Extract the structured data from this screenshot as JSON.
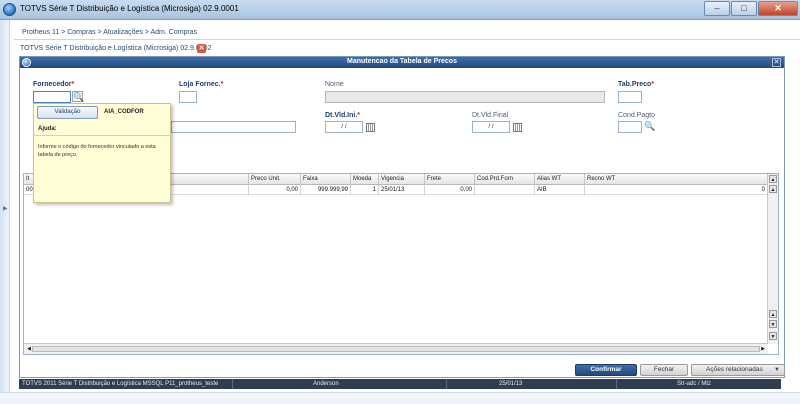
{
  "window": {
    "title": "TOTVS Série T Distribuição e Logística (Microsiga) 02.9.0001",
    "controls": {
      "minimize": "–",
      "maximize": "□",
      "close": "✕"
    }
  },
  "breadcrumb": "Protheus 11 > Compras > Atualizações > Adm. Compras",
  "subheader": {
    "title": "TOTVS Série T Distribuição e Logística (Microsiga) 02.9.0002",
    "close_glyph": "✕"
  },
  "dialog": {
    "title": "Manutencao da Tabela de Precos",
    "close_glyph": "✕",
    "fields": {
      "fornecedor": {
        "label": "Fornecedor",
        "value": ""
      },
      "loja": {
        "label": "Loja Fornec.",
        "value": ""
      },
      "nome": {
        "label": "Nome",
        "value": ""
      },
      "tab_preco": {
        "label": "Tab.Preco",
        "value": ""
      },
      "dt_vld_ini": {
        "label": "Dt.Vld.Ini.",
        "value": " /  /"
      },
      "dt_vld_final": {
        "label": "Dt.Vld.Final",
        "value": " /  /"
      },
      "cond_pagto": {
        "label": "Cond.Pagto",
        "value": ""
      },
      "descricao": {
        "value": ""
      }
    },
    "required_mark": "*"
  },
  "tooltip": {
    "button_label": "Validação",
    "field_name": "AIA_CODFOR",
    "heading": "Ajuda:",
    "message": "Informe o código do fornecedor vinculado a esta tabela de preço."
  },
  "grid": {
    "columns": {
      "c0": "It",
      "c1": "",
      "preco_unit": "Preco Unit.",
      "faixa": "Faixa",
      "moeda": "Moeda",
      "vigencia": "Vigencia",
      "frete": "Frete",
      "cod_prd_forn": "Cod.Prd.Forn",
      "alias_wt": "Alias WT",
      "recno_wt": "Recno WT"
    },
    "row": {
      "c0": "00",
      "c1": "",
      "preco_unit": "0,00",
      "faixa": "999.999,99",
      "moeda": "1",
      "vigencia": "25/01/13",
      "frete": "0,00",
      "cod_prd_forn": "",
      "alias_wt": "AIB",
      "recno_wt": "0"
    }
  },
  "buttons": {
    "confirmar": "Confirmar",
    "fechar": "Fechar",
    "acoes": "Ações relacionadas"
  },
  "statusbar": {
    "environment": "TOTVS 2011 Série T Distribuição e Logística MSSQL P11_protheus_teste",
    "user": "Anderson",
    "date": "25/01/13",
    "company": "Str-adc / Mtz"
  },
  "icons": {
    "lookup": "magnifier-icon",
    "calendar": "calendar-icon"
  },
  "colors": {
    "accent": "#22497d",
    "required_star": "#cc1a1a",
    "tooltip_bg": "#fffed6",
    "statusbar_bg": "#2f3d50"
  }
}
